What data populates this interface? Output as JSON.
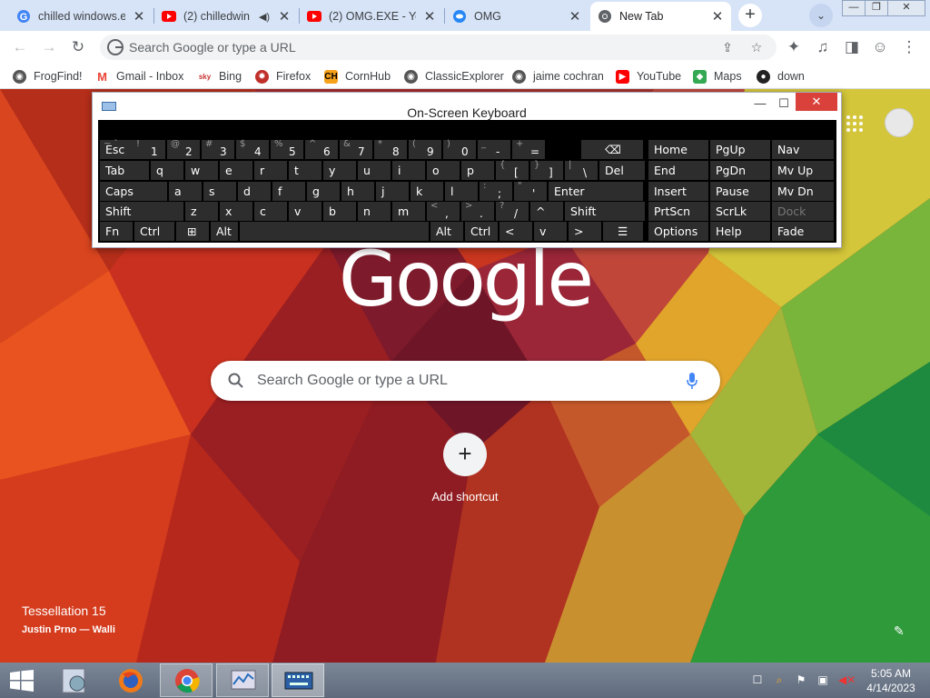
{
  "tabs": [
    {
      "title": "chilled windows.e",
      "icon": "google-icon"
    },
    {
      "title": "(2) chilledwin",
      "icon": "youtube-icon"
    },
    {
      "title": "(2) OMG.EXE - Yo",
      "icon": "youtube-icon"
    },
    {
      "title": "OMG",
      "icon": "vk-icon"
    },
    {
      "title": "New Tab",
      "icon": "chrome-icon"
    }
  ],
  "window_controls": {
    "min": "—",
    "restore": "❐",
    "close": "✕"
  },
  "omnibox": {
    "placeholder": "Search Google or type a URL"
  },
  "bookmarks": [
    "FrogFind!",
    "Gmail - Inbox",
    "Bing",
    "Firefox",
    "CornHub",
    "ClassicExplorer",
    "jaime cochran",
    "YouTube",
    "Maps",
    "down"
  ],
  "ntp": {
    "logo": "Google",
    "search_placeholder": "Search Google or type a URL",
    "add_shortcut": "Add shortcut",
    "background_title": "Tessellation 15",
    "background_author": "Justin Prno — Walli"
  },
  "osk": {
    "title": "On-Screen Keyboard",
    "row1": [
      "Esc",
      "1",
      "2",
      "3",
      "4",
      "5",
      "6",
      "7",
      "8",
      "9",
      "0",
      "-",
      "="
    ],
    "row1_shift": [
      "~ `",
      "!",
      "@",
      "#",
      "$",
      "%",
      "^",
      "&",
      "*",
      "(",
      ")",
      "_",
      "+"
    ],
    "row2": [
      "Tab",
      "q",
      "w",
      "e",
      "r",
      "t",
      "y",
      "u",
      "i",
      "o",
      "p",
      "[",
      "]",
      "\\",
      "Del"
    ],
    "row2_shift": [
      "",
      "",
      "",
      "",
      "",
      "",
      "",
      "",
      "",
      "",
      "",
      "{",
      "}",
      "|",
      ""
    ],
    "row3": [
      "Caps",
      "a",
      "s",
      "d",
      "f",
      "g",
      "h",
      "j",
      "k",
      "l",
      ";",
      "'",
      "Enter"
    ],
    "row3_shift": [
      "",
      "",
      "",
      "",
      "",
      "",
      "",
      "",
      "",
      "",
      ":",
      "\"",
      ""
    ],
    "row4": [
      "Shift",
      "z",
      "x",
      "c",
      "v",
      "b",
      "n",
      "m",
      ",",
      ".",
      "/",
      "^",
      "Shift"
    ],
    "row4_shift": [
      "",
      "",
      "",
      "",
      "",
      "",
      "",
      "",
      "<",
      ">",
      "?",
      "",
      ""
    ],
    "row5": [
      "Fn",
      "Ctrl",
      "Alt",
      "Alt",
      "Ctrl",
      "<",
      "v",
      ">"
    ],
    "nav": [
      [
        "Home",
        "PgUp",
        "Nav"
      ],
      [
        "End",
        "PgDn",
        "Mv Up"
      ],
      [
        "Insert",
        "Pause",
        "Mv Dn"
      ],
      [
        "PrtScn",
        "ScrLk",
        "Dock"
      ],
      [
        "Options",
        "Help",
        "Fade"
      ]
    ]
  },
  "taskbar": {
    "clock_time": "5:05 AM",
    "clock_date": "4/14/2023"
  },
  "colors": {
    "tabstrip": "#d7e3f7",
    "taskbar": "#6e7a8a",
    "osk_key": "#2d2d2d",
    "close_red": "#d9413a"
  }
}
